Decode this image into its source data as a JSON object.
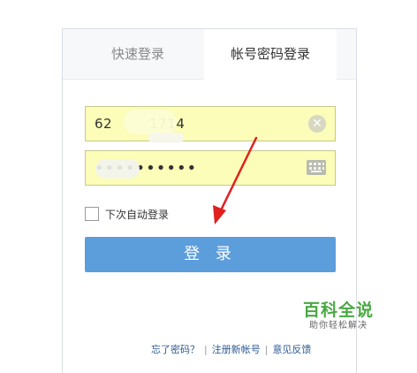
{
  "tabs": {
    "quick_login": "快速登录",
    "account_login": "帐号密码登录"
  },
  "form": {
    "username_value": "62        1714",
    "password_value": "••••••••••",
    "remember_label": "下次自动登录",
    "login_button": "登 录"
  },
  "links": {
    "forgot_password": "忘了密码？",
    "register": "注册新帐号",
    "feedback": "意见反馈"
  },
  "icons": {
    "clear": "clear-icon",
    "keyboard": "keyboard-icon",
    "annotation_arrow": "arrow-icon"
  },
  "watermark": {
    "title": "百科全说",
    "subtitle": "助你轻松解决"
  },
  "colors": {
    "input_bg": "#fbfdb8",
    "button": "#5c9ddc",
    "arrow": "#e02020",
    "watermark": "#4aa843"
  }
}
